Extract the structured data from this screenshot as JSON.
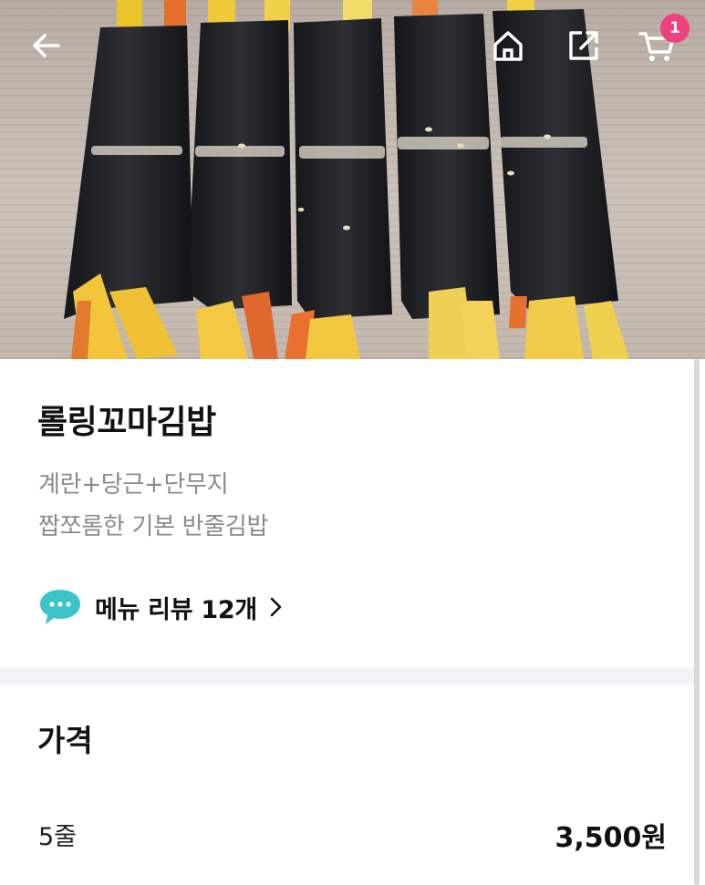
{
  "header": {
    "back_icon": "arrow-left-icon",
    "home_icon": "home-icon",
    "share_icon": "share-icon",
    "cart_icon": "cart-icon",
    "cart_count": "1",
    "badge_color": "#f0417f"
  },
  "product": {
    "name": "롤링꼬마김밥",
    "description_lines": [
      "계란+당근+단무지",
      "짭쪼롬한 기본 반줄김밥"
    ],
    "review_icon": "chat-bubble-icon",
    "review_label": "메뉴 리뷰 12개",
    "review_icon_color": "#3cc5c8"
  },
  "price_section": {
    "title": "가격",
    "options": [
      {
        "label": "5줄",
        "price": "3,500원"
      }
    ]
  }
}
